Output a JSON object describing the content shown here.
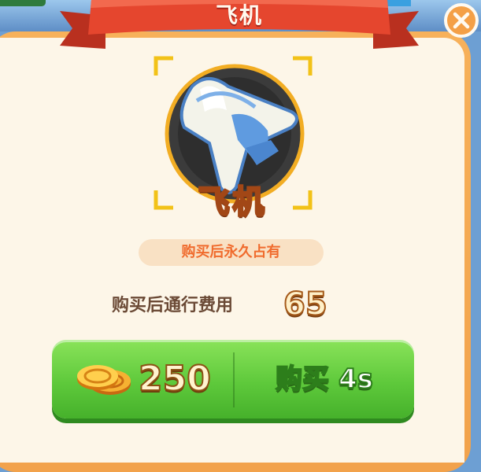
{
  "dialog": {
    "title": "飞机",
    "item_name": "飞机",
    "item_icon": "airplane-icon",
    "permanent_note": "购买后永久占有",
    "fee_label": "购买后通行费用",
    "fee_value": "65"
  },
  "buy_button": {
    "price": "250",
    "currency_icon": "gold-coins-icon",
    "label": "购买 4s"
  },
  "colors": {
    "ribbon": "#e5462e",
    "panel": "#fdf6e8",
    "frame": "#f2a24b",
    "button": "#5ec93b",
    "accent_orange": "#f06b2d"
  }
}
